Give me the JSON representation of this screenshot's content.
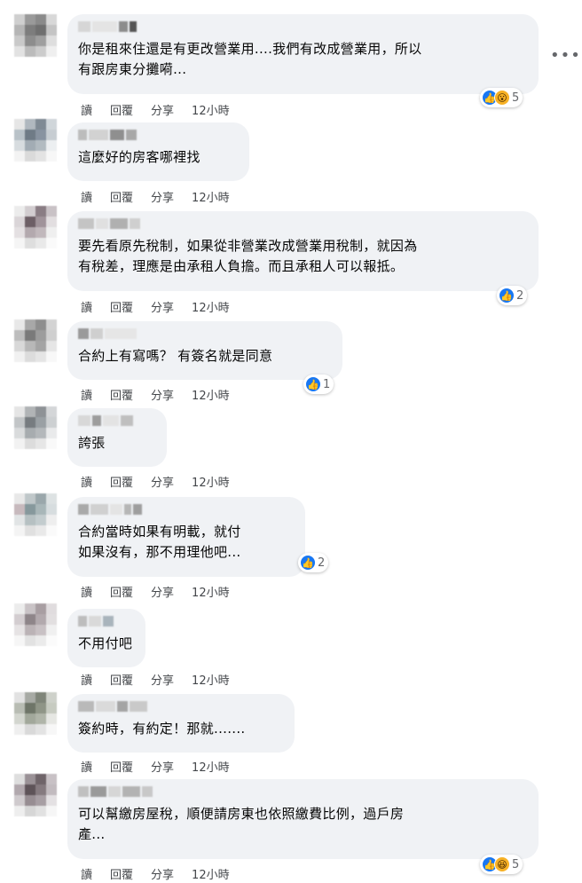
{
  "actions": {
    "read": "讀",
    "reply": "回覆",
    "share": "分享"
  },
  "more_label": "•••",
  "comments": [
    {
      "text": "你是租來住還是有更改營業用....我們有改成營業用，所以\n有跟房東分攤嗬...",
      "time": "12小時",
      "reaction_count": "5",
      "reactions": [
        "like-icon",
        "wow-icon"
      ]
    },
    {
      "text": "這麼好的房客哪裡找",
      "time": "12小時"
    },
    {
      "text": "要先看原先稅制，如果從非營業改成營業用稅制，就因為\n有稅差，理應是由承租人負擔。而且承租人可以報抵。",
      "time": "12小時",
      "reaction_count": "2",
      "reactions": [
        "like-icon"
      ]
    },
    {
      "text": "合約上有寫嗎？ 有簽名就是同意",
      "time": "12小時",
      "reaction_count": "1",
      "reactions": [
        "like-icon"
      ]
    },
    {
      "text": "誇張",
      "time": "12小時"
    },
    {
      "text": "合約當時如果有明載，就付\n如果沒有，那不用理他吧...",
      "time": "12小時",
      "reaction_count": "2",
      "reactions": [
        "like-icon"
      ]
    },
    {
      "text": "不用付吧",
      "time": "12小時"
    },
    {
      "text": "簽約時，有約定！那就.......",
      "time": "12小時"
    },
    {
      "text": "可以幫繳房屋稅，順便請房東也依照繳費比例，過戶房\n產...",
      "time": "12小時",
      "reaction_count": "5",
      "reactions": [
        "like-icon",
        "haha-icon"
      ]
    }
  ],
  "colors": {
    "bubble": "#f0f2f5",
    "like": "#1877f2",
    "meta": "#44474b"
  }
}
